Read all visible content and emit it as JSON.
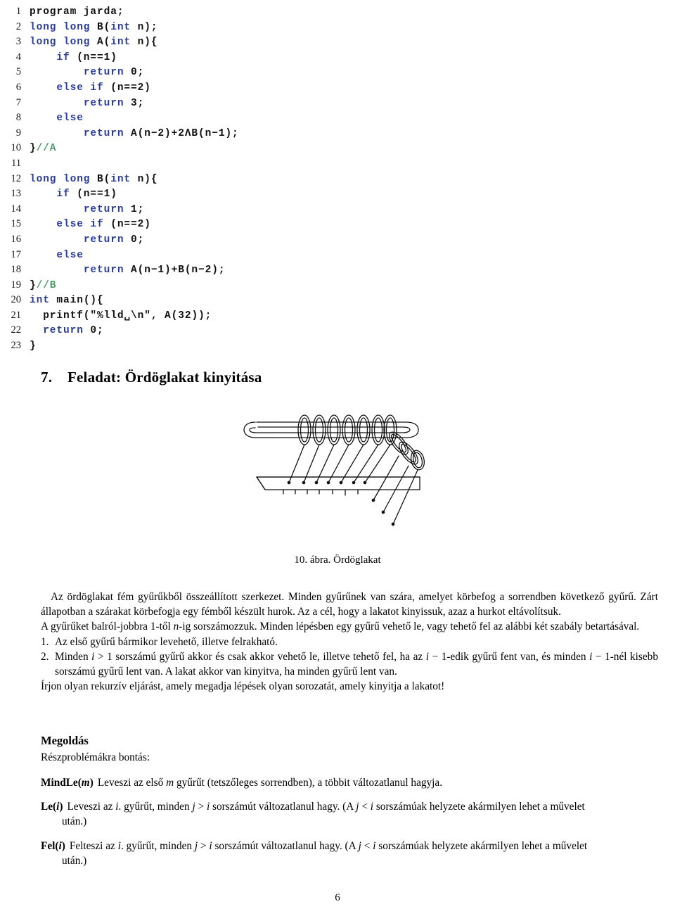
{
  "colors": {
    "keyword": "#2b3d9b",
    "comment": "#4f9d6d",
    "plain": "#111111",
    "page_bg": "#ffffff",
    "text": "#000000"
  },
  "code_listing": {
    "language": "C",
    "lines": [
      {
        "n": "1",
        "tokens": [
          {
            "t": "program jarda;",
            "c": "pl"
          }
        ]
      },
      {
        "n": "2",
        "tokens": [
          {
            "t": "long long ",
            "c": "kw"
          },
          {
            "t": "B(",
            "c": "pl"
          },
          {
            "t": "int",
            "c": "kw"
          },
          {
            "t": " n);",
            "c": "pl"
          }
        ]
      },
      {
        "n": "3",
        "tokens": [
          {
            "t": "long long ",
            "c": "kw"
          },
          {
            "t": "A(",
            "c": "pl"
          },
          {
            "t": "int",
            "c": "kw"
          },
          {
            "t": " n){",
            "c": "pl"
          }
        ]
      },
      {
        "n": "4",
        "tokens": [
          {
            "t": "    ",
            "c": "pl"
          },
          {
            "t": "if",
            "c": "kw"
          },
          {
            "t": " (n==1)",
            "c": "pl"
          }
        ]
      },
      {
        "n": "5",
        "tokens": [
          {
            "t": "        ",
            "c": "pl"
          },
          {
            "t": "return",
            "c": "kw"
          },
          {
            "t": " 0;",
            "c": "pl"
          }
        ]
      },
      {
        "n": "6",
        "tokens": [
          {
            "t": "    ",
            "c": "pl"
          },
          {
            "t": "else if",
            "c": "kw"
          },
          {
            "t": " (n==2)",
            "c": "pl"
          }
        ]
      },
      {
        "n": "7",
        "tokens": [
          {
            "t": "        ",
            "c": "pl"
          },
          {
            "t": "return",
            "c": "kw"
          },
          {
            "t": " 3;",
            "c": "pl"
          }
        ]
      },
      {
        "n": "8",
        "tokens": [
          {
            "t": "    ",
            "c": "pl"
          },
          {
            "t": "else",
            "c": "kw"
          }
        ]
      },
      {
        "n": "9",
        "tokens": [
          {
            "t": "        ",
            "c": "pl"
          },
          {
            "t": "return",
            "c": "kw"
          },
          {
            "t": " A(n−2)+2ΛB(n−1);",
            "c": "pl"
          }
        ]
      },
      {
        "n": "10",
        "tokens": [
          {
            "t": "}",
            "c": "pl"
          },
          {
            "t": "//A",
            "c": "cm"
          }
        ]
      },
      {
        "n": "11",
        "tokens": [
          {
            "t": "",
            "c": "pl"
          }
        ]
      },
      {
        "n": "12",
        "tokens": [
          {
            "t": "long long ",
            "c": "kw"
          },
          {
            "t": "B(",
            "c": "pl"
          },
          {
            "t": "int",
            "c": "kw"
          },
          {
            "t": " n){",
            "c": "pl"
          }
        ]
      },
      {
        "n": "13",
        "tokens": [
          {
            "t": "    ",
            "c": "pl"
          },
          {
            "t": "if",
            "c": "kw"
          },
          {
            "t": " (n==1)",
            "c": "pl"
          }
        ]
      },
      {
        "n": "14",
        "tokens": [
          {
            "t": "        ",
            "c": "pl"
          },
          {
            "t": "return",
            "c": "kw"
          },
          {
            "t": " 1;",
            "c": "pl"
          }
        ]
      },
      {
        "n": "15",
        "tokens": [
          {
            "t": "    ",
            "c": "pl"
          },
          {
            "t": "else if",
            "c": "kw"
          },
          {
            "t": " (n==2)",
            "c": "pl"
          }
        ]
      },
      {
        "n": "16",
        "tokens": [
          {
            "t": "        ",
            "c": "pl"
          },
          {
            "t": "return",
            "c": "kw"
          },
          {
            "t": " 0;",
            "c": "pl"
          }
        ]
      },
      {
        "n": "17",
        "tokens": [
          {
            "t": "    ",
            "c": "pl"
          },
          {
            "t": "else",
            "c": "kw"
          }
        ]
      },
      {
        "n": "18",
        "tokens": [
          {
            "t": "        ",
            "c": "pl"
          },
          {
            "t": "return",
            "c": "kw"
          },
          {
            "t": " A(n−1)+B(n−2);",
            "c": "pl"
          }
        ]
      },
      {
        "n": "19",
        "tokens": [
          {
            "t": "}",
            "c": "pl"
          },
          {
            "t": "//B",
            "c": "cm"
          }
        ]
      },
      {
        "n": "20",
        "tokens": [
          {
            "t": "int",
            "c": "kw"
          },
          {
            "t": " main(){",
            "c": "pl"
          }
        ]
      },
      {
        "n": "21",
        "tokens": [
          {
            "t": "  ",
            "c": "pl"
          },
          {
            "t": "printf(\"%lld␣\\n\", A(32));",
            "c": "pl"
          }
        ]
      },
      {
        "n": "22",
        "tokens": [
          {
            "t": "  ",
            "c": "pl"
          },
          {
            "t": "return",
            "c": "kw"
          },
          {
            "t": " 0;",
            "c": "pl"
          }
        ]
      },
      {
        "n": "23",
        "tokens": [
          {
            "t": "}",
            "c": "pl"
          }
        ]
      }
    ]
  },
  "section": {
    "number": "7.",
    "title": "Feladat: Ördöglakat kinyitása"
  },
  "figure": {
    "name": "ordoglakat-illustration",
    "caption": "10. ábra. Ördöglakat",
    "alt": "Ördöglakat: fém gyűrűkből összeállított szerkezet, gyűrűk szárakkal és hurokkal"
  },
  "body": {
    "paragraph1": "Az ördöglakat fém gyűrűkből összeállított szerkezet. Minden gyűrűnek van szára, amelyet körbefog a sorrendben következő gyűrű. Zárt állapotban a szárakat körbefogja egy fémből készült hurok. Az a cél, hogy a lakatot kinyissuk, azaz a hurkot eltávolítsuk.",
    "paragraph2": "A gyűrűket balról-jobbra 1-től n-ig sorszámozzuk. Minden lépésben egy gyűrű vehető le, vagy tehető fel az alábbi két szabály betartásával.",
    "rules": [
      {
        "num": "1.",
        "text": "Az első gyűrű bármikor levehető, illetve felrakható."
      },
      {
        "num": "2.",
        "text": "Minden i > 1 sorszámú gyűrű akkor és csak akkor vehető le, illetve tehető fel, ha az i − 1-edik gyűrű fent van, és minden i − 1-nél kisebb sorszámú gyűrű lent van. A lakat akkor van kinyitva, ha minden gyűrű lent van."
      }
    ],
    "paragraph3": "Írjon olyan rekurzív eljárást, amely megadja lépések olyan sorozatát, amely kinyitja a lakatot!"
  },
  "solution": {
    "heading": "Megoldás",
    "intro": "Részproblémákra bontás:",
    "definitions": [
      {
        "term": "MindLe(m)",
        "text": "Leveszi az első m gyűrűt (tetszőleges sorrendben), a többit változatlanul hagyja.",
        "cont": ""
      },
      {
        "term": "Le(i)",
        "text": "Leveszi az i. gyűrűt, minden j > i sorszámút változatlanul hagy. (A j < i sorszámúak helyzete akármilyen lehet a művelet",
        "cont": "után.)"
      },
      {
        "term": "Fel(i)",
        "text": "Felteszi az i. gyűrűt, minden j > i sorszámút változatlanul hagy. (A j < i sorszámúak helyzete akármilyen lehet a művelet",
        "cont": "után.)"
      }
    ]
  },
  "page_number": "6"
}
